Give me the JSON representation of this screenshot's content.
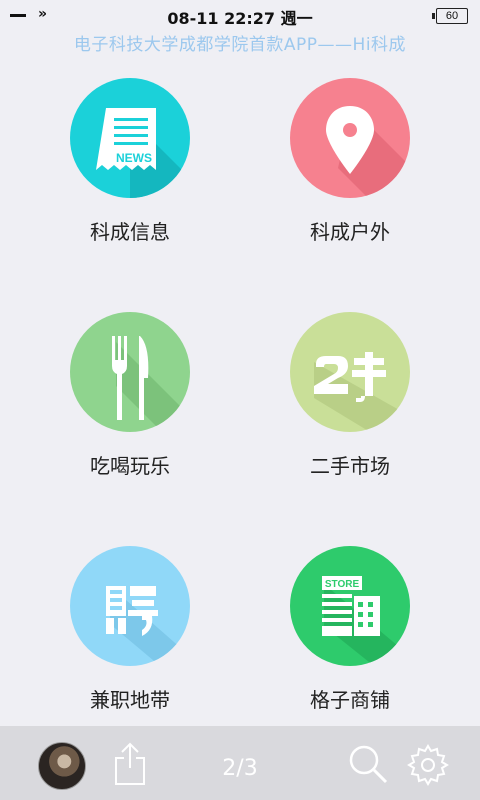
{
  "status_bar": {
    "datetime": "08-11 22:27 週一",
    "forward_glyph": "»",
    "battery": "60"
  },
  "ticker": "电子科技大学成都学院首款APP——Hi科成",
  "tiles": [
    {
      "label": "科成信息",
      "icon": "news-icon",
      "color": "#1bd1d9"
    },
    {
      "label": "科成户外",
      "icon": "location-pin-icon",
      "color": "#f6818f"
    },
    {
      "label": "吃喝玩乐",
      "icon": "fork-knife-icon",
      "color": "#8fd48e"
    },
    {
      "label": "二手市场",
      "icon": "second-hand-icon",
      "color": "#c9df98"
    },
    {
      "label": "兼职地带",
      "icon": "recruit-icon",
      "color": "#90d8f8"
    },
    {
      "label": "格子商铺",
      "icon": "store-icon",
      "color": "#2ecb6c"
    }
  ],
  "toolbar": {
    "page_indicator": "2/3",
    "share_icon": "share-icon",
    "search_icon": "search-icon",
    "settings_icon": "gear-icon"
  }
}
